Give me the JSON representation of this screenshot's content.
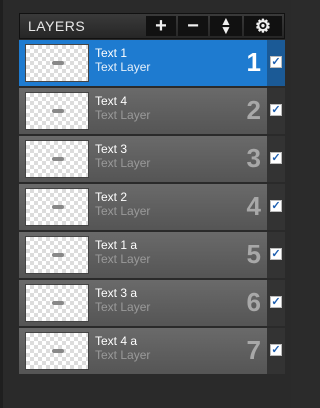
{
  "panel": {
    "title": "LAYERS",
    "buttons": {
      "add": "+",
      "remove": "−",
      "reorder_up": "▲",
      "reorder_down": "▼",
      "settings": "⚙"
    }
  },
  "layers": [
    {
      "name": "Text 1",
      "type": "Text Layer",
      "number": "1",
      "selected": true,
      "visible": true
    },
    {
      "name": "Text 4",
      "type": "Text Layer",
      "number": "2",
      "selected": false,
      "visible": true
    },
    {
      "name": "Text 3",
      "type": "Text Layer",
      "number": "3",
      "selected": false,
      "visible": true
    },
    {
      "name": "Text 2",
      "type": "Text Layer",
      "number": "4",
      "selected": false,
      "visible": true
    },
    {
      "name": "Text 1 a",
      "type": "Text Layer",
      "number": "5",
      "selected": false,
      "visible": true
    },
    {
      "name": "Text 3 a",
      "type": "Text Layer",
      "number": "6",
      "selected": false,
      "visible": true
    },
    {
      "name": "Text 4 a",
      "type": "Text Layer",
      "number": "7",
      "selected": false,
      "visible": true
    }
  ],
  "colors": {
    "selected": "#1e7bd0",
    "row": "#5f5f5f",
    "background": "#2a2a2a"
  },
  "icons": {
    "checkbox": "✓"
  }
}
